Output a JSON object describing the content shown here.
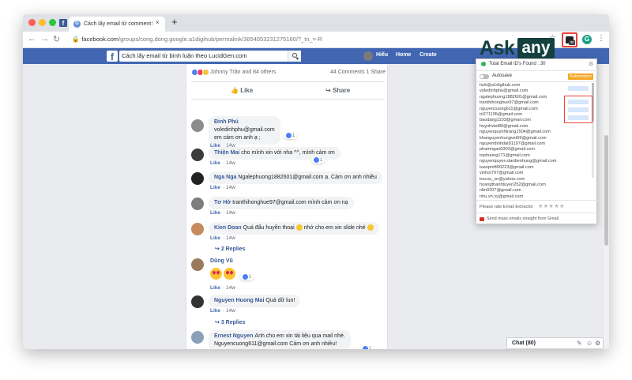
{
  "browser": {
    "tab_title": "Cách lấy email từ comment face",
    "tab_close": "×",
    "new_tab": "+",
    "url_domain": "facebook.com",
    "url_path": "/groups/cong.dong.google.a1digihub/permalink/365405323127516​0/?_tn_=-R",
    "tab_favicon_letter": "f",
    "g_ext_letter": "G"
  },
  "watermark": {
    "ask": "Ask",
    "any": "any"
  },
  "facebook": {
    "logo": "f",
    "search_value": "Cách lấy email từ bình luận theo LucidGen.com",
    "nav_user": "Hiếu",
    "nav_home": "Home",
    "nav_create": "Create"
  },
  "post": {
    "reaction_text": "Johnny Trần and 84 others",
    "counts": "44 Comments  1 Share",
    "like_label": "Like",
    "share_label": "Share"
  },
  "comments": [
    {
      "name": "Đinh Phú",
      "text": "voledinhphu@gmail.com",
      "text2": "em cảm ơn anh ạ ;",
      "time": "14w",
      "likes": "1"
    },
    {
      "name": "Thiện Mai",
      "text": "cho mình xin với nha ^^, mình cảm ơn",
      "time": "14w",
      "likes": "1"
    },
    {
      "name": "Nga Nga",
      "text": "Ngalephuong1882601@gmail.com ạ. Cảm ơn anh nhiều",
      "time": "14w"
    },
    {
      "name": "Tơ Hờ",
      "text": "tranthihonghue97@gmail.com mình cảm ơn nạ",
      "time": "14w"
    },
    {
      "name": "Kien Doan",
      "text": "Quá đẩu huyền thoại",
      "text_tail": "nhớ cho em xin slide nhé",
      "time": "14w",
      "replies": "2 Replies"
    },
    {
      "name": "Dũng Vũ",
      "time": "14w",
      "likes": "1"
    },
    {
      "name": "Nguyen Huong Mai",
      "text": "Quá dữ lun!",
      "time": "14w",
      "replies": "3 Replies"
    },
    {
      "name": "Ernest Nguyen",
      "text": "Anh cho em xin tài liệu qua mail nhé.",
      "text2": "Nguyencuong611@gmail.com Cảm ơn anh nhiều!",
      "time": "14w",
      "likes": "1"
    }
  ],
  "meta_like": "Like",
  "meta_sep": "·",
  "chat": {
    "label": "Chat (80)"
  },
  "extension": {
    "title": "Total Email ID's Found : 30",
    "autosave": "Autosave",
    "automation": "Automation",
    "emails": [
      "hub@a1digihub.com",
      "voledinhphu@gmail.com",
      "ngalephuong1882601@gmail.com",
      "tranthihonghue97@gmail.com",
      "nguyencuong611@gmail.com",
      "tri271195@gmail.com",
      "baodang1103@gmail.com",
      "huynhviet89@gmail.com",
      "nguyenquynhtrang1504@gmail.com",
      "khanguyenhungvet09@gmail.com",
      "nguyendinhdat91197@gmail.com",
      "phamngan0303@gmail.com",
      "tophuong171@gmail.com",
      "nguyenquyen.dardienhung@gmail.com",
      "tuanpmft00223@gmail.com",
      "vinhot797@gmail.com",
      "trucxo_vn@yahoo.com",
      "hoangthanhtuyen252@gmail.com",
      "nltn0207@gmail.com",
      "nhu.vn.vy@gmail.com"
    ],
    "rate": "Please rate Email Extractor",
    "stars": "★★★★★",
    "gmail": "Send mass emails straight from Gmail"
  },
  "colors": {
    "facebook_blue": "#4267b2",
    "highlight_red": "#e8473a",
    "automation_orange": "#f5a623",
    "askany_teal": "#14403f"
  }
}
